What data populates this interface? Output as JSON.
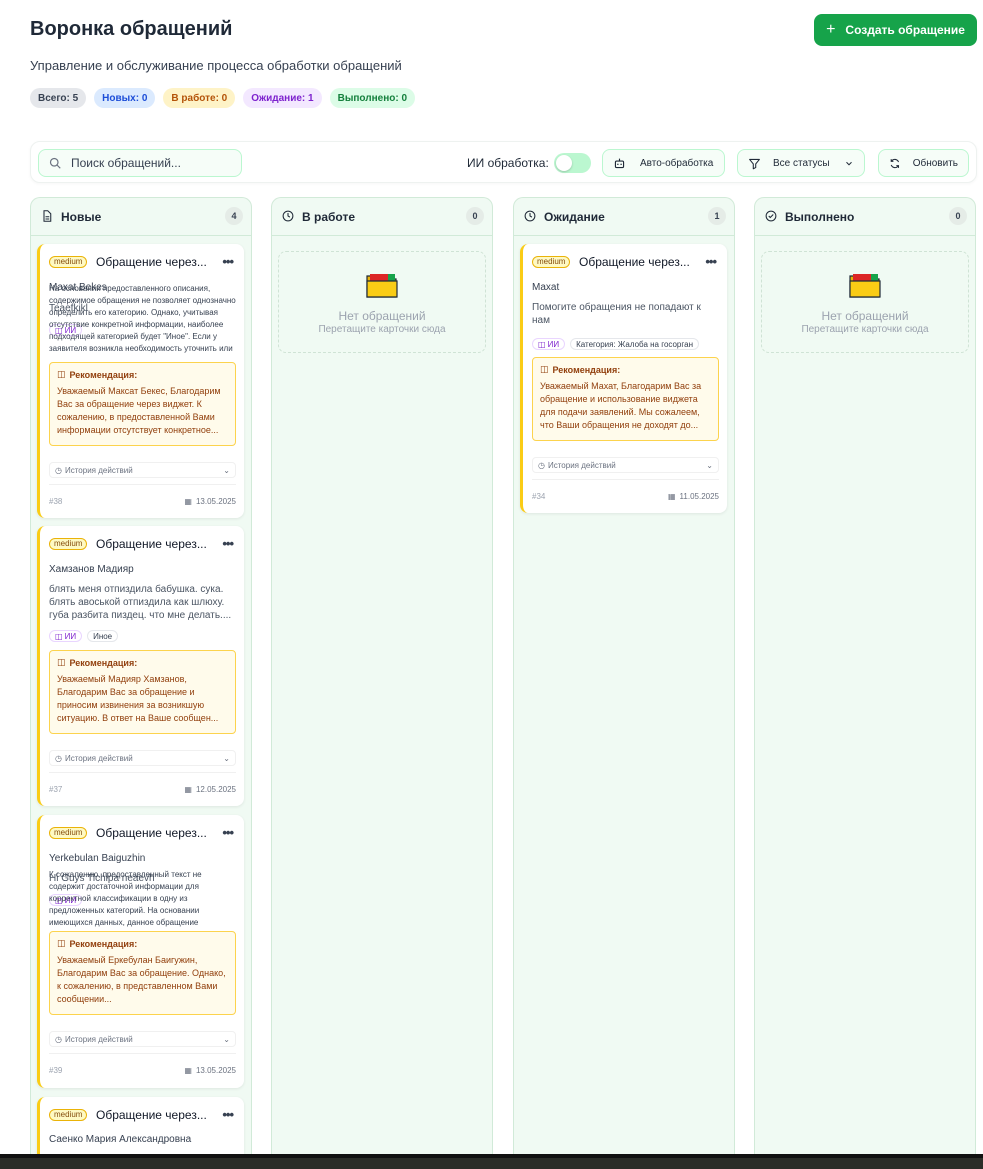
{
  "header": {
    "title": "Воронка обращений",
    "subtitle": "Управление и обслуживание процесса обработки обращений",
    "create_button": "Создать обращение"
  },
  "stats": {
    "all": "Всего: 5",
    "new": "Новых: 0",
    "work": "В работе: 0",
    "wait": "Ожидание: 1",
    "done": "Выполнено: 0"
  },
  "toolbar": {
    "search_placeholder": "Поиск обращений...",
    "ai_label": "ИИ обработка:",
    "ai_enabled": false,
    "auto_button": "Авто-обработка",
    "status_filter": "Все статусы",
    "refresh_button": "Обновить"
  },
  "columns": {
    "new": {
      "title": "Новые",
      "count": "4"
    },
    "work": {
      "title": "В работе",
      "count": "0",
      "empty_title": "Нет обращений",
      "empty_hint": "Перетащите карточки сюда"
    },
    "wait": {
      "title": "Ожидание",
      "count": "1"
    },
    "done": {
      "title": "Выполнено",
      "count": "0",
      "empty_title": "Нет обращений",
      "empty_hint": "Перетащите карточки сюда"
    }
  },
  "cards": {
    "c38": {
      "priority": "medium",
      "title": "Обращение через...",
      "author": "Maxat Bekes",
      "desc": "Teaefkikl",
      "overlay": "На основании предоставленного описания, содержимое обращения не позволяет однозначно определить его категорию. Однако, учитывая отсутствие конкретной информации, наиболее подходящей категорией будет \"Иное\". Если у заявителя возникла необходимость уточнить или",
      "tag_ai": "ИИ",
      "rec_title": "Рекомендация:",
      "rec_text": "Уважаемый Максат Бекес, Благодарим Вас за обращение через виджет. К сожалению, в предоставленной Вами информации отсутствует конкретное...",
      "history": "История действий",
      "id": "#38",
      "date": "13.05.2025"
    },
    "c37": {
      "priority": "medium",
      "title": "Обращение через...",
      "author": "Хамзанов Мадияр",
      "desc": "блять меня отпиздила бабушка. сука. блять авоськой отпиздила как шлюху. губа разбита пиздец. что мне делать....",
      "tag_ai": "ИИ",
      "tag_cat": "Иное",
      "rec_title": "Рекомендация:",
      "rec_text": "Уважаемый Мадияр Хамзанов, Благодарим Вас за обращение и приносим извинения за возникшую ситуацию. В ответ на Ваше сообщен...",
      "history": "История действий",
      "id": "#37",
      "date": "12.05.2025"
    },
    "c39": {
      "priority": "medium",
      "title": "Обращение через...",
      "author": "Yerkebulan Baiguzhin",
      "desc": "Hi Guys Tichipa neaevh",
      "overlay": "К сожалению, предоставленный текст не содержит достаточной информации для корректной классификации в одну из предложенных категорий. На основании имеющихся данных, данное обращение",
      "tag_ai": "ИИ",
      "rec_title": "Рекомендация:",
      "rec_text": "Уважаемый Еркебулан Баигужин, Благодарим Вас за обращение. Однако, к сожалению, в представленном Вами сообщении...",
      "history": "История действий",
      "id": "#39",
      "date": "13.05.2025"
    },
    "c40": {
      "priority": "medium",
      "title": "Обращение через...",
      "author": "Саенко Мария Александровна"
    },
    "c34": {
      "priority": "medium",
      "title": "Обращение через...",
      "author": "Maxat",
      "desc": "Помогите обращения не попадают к нам",
      "tag_ai": "ИИ",
      "tag_cat": "Категория: Жалоба на госорган",
      "rec_title": "Рекомендация:",
      "rec_text": "Уважаемый Махат, Благодарим Вас за обращение и использование виджета для подачи заявлений. Мы сожалеем, что Ваши обращения не доходят до...",
      "history": "История действий",
      "id": "#34",
      "date": "11.05.2025"
    }
  },
  "colors": {
    "accent": "#16a34a",
    "column_bg": "#f0faf3",
    "priority_border": "#facc15",
    "recommendation_bg": "#fffbeb"
  }
}
